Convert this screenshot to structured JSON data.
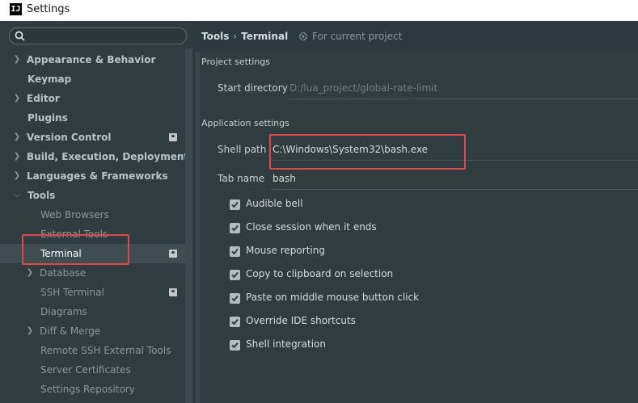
{
  "window": {
    "title": "Settings",
    "app_icon": "IJ"
  },
  "search": {
    "placeholder": "",
    "value": ""
  },
  "tree": [
    {
      "label": "Appearance & Behavior",
      "style": "bold",
      "expandable": true
    },
    {
      "label": "Keymap",
      "style": "bold",
      "expandable": false
    },
    {
      "label": "Editor",
      "style": "bold",
      "expandable": true
    },
    {
      "label": "Plugins",
      "style": "bold",
      "expandable": false
    },
    {
      "label": "Version Control",
      "style": "bold",
      "expandable": true,
      "badge": true
    },
    {
      "label": "Build, Execution, Deployment",
      "style": "bold",
      "expandable": true
    },
    {
      "label": "Languages & Frameworks",
      "style": "bold",
      "expandable": true
    },
    {
      "label": "Tools",
      "style": "bold",
      "expanded": true
    },
    {
      "label": "Web Browsers",
      "style": "child"
    },
    {
      "label": "External Tools",
      "style": "child"
    },
    {
      "label": "Terminal",
      "style": "child",
      "selected": true,
      "badge": true
    },
    {
      "label": "Database",
      "style": "child",
      "expandable": true
    },
    {
      "label": "SSH Terminal",
      "style": "child",
      "badge": true
    },
    {
      "label": "Diagrams",
      "style": "child"
    },
    {
      "label": "Diff & Merge",
      "style": "child",
      "expandable": true
    },
    {
      "label": "Remote SSH External Tools",
      "style": "child"
    },
    {
      "label": "Server Certificates",
      "style": "child"
    },
    {
      "label": "Settings Repository",
      "style": "child"
    }
  ],
  "breadcrumb": {
    "parent": "Tools",
    "separator": "›",
    "current": "Terminal",
    "scope": "For current project"
  },
  "project_settings": {
    "title": "Project settings",
    "start_directory": {
      "label": "Start directory",
      "value": "D:/lua_project/global-rate-limit"
    }
  },
  "app_settings": {
    "title": "Application settings",
    "shell_path": {
      "label": "Shell path",
      "value": "C:\\Windows\\System32\\bash.exe"
    },
    "tab_name": {
      "label": "Tab name",
      "value": "bash"
    },
    "checkboxes": [
      {
        "label": "Audible bell",
        "checked": true
      },
      {
        "label": "Close session when it ends",
        "checked": true
      },
      {
        "label": "Mouse reporting",
        "checked": true
      },
      {
        "label": "Copy to clipboard on selection",
        "checked": true
      },
      {
        "label": "Paste on middle mouse button click",
        "checked": true
      },
      {
        "label": "Override IDE shortcuts",
        "checked": true
      },
      {
        "label": "Shell integration",
        "checked": true
      }
    ]
  },
  "colors": {
    "highlight_box": "#e0474c",
    "checkbox_fill": "#b3bcbe",
    "check_mark": "#2f3c40"
  }
}
